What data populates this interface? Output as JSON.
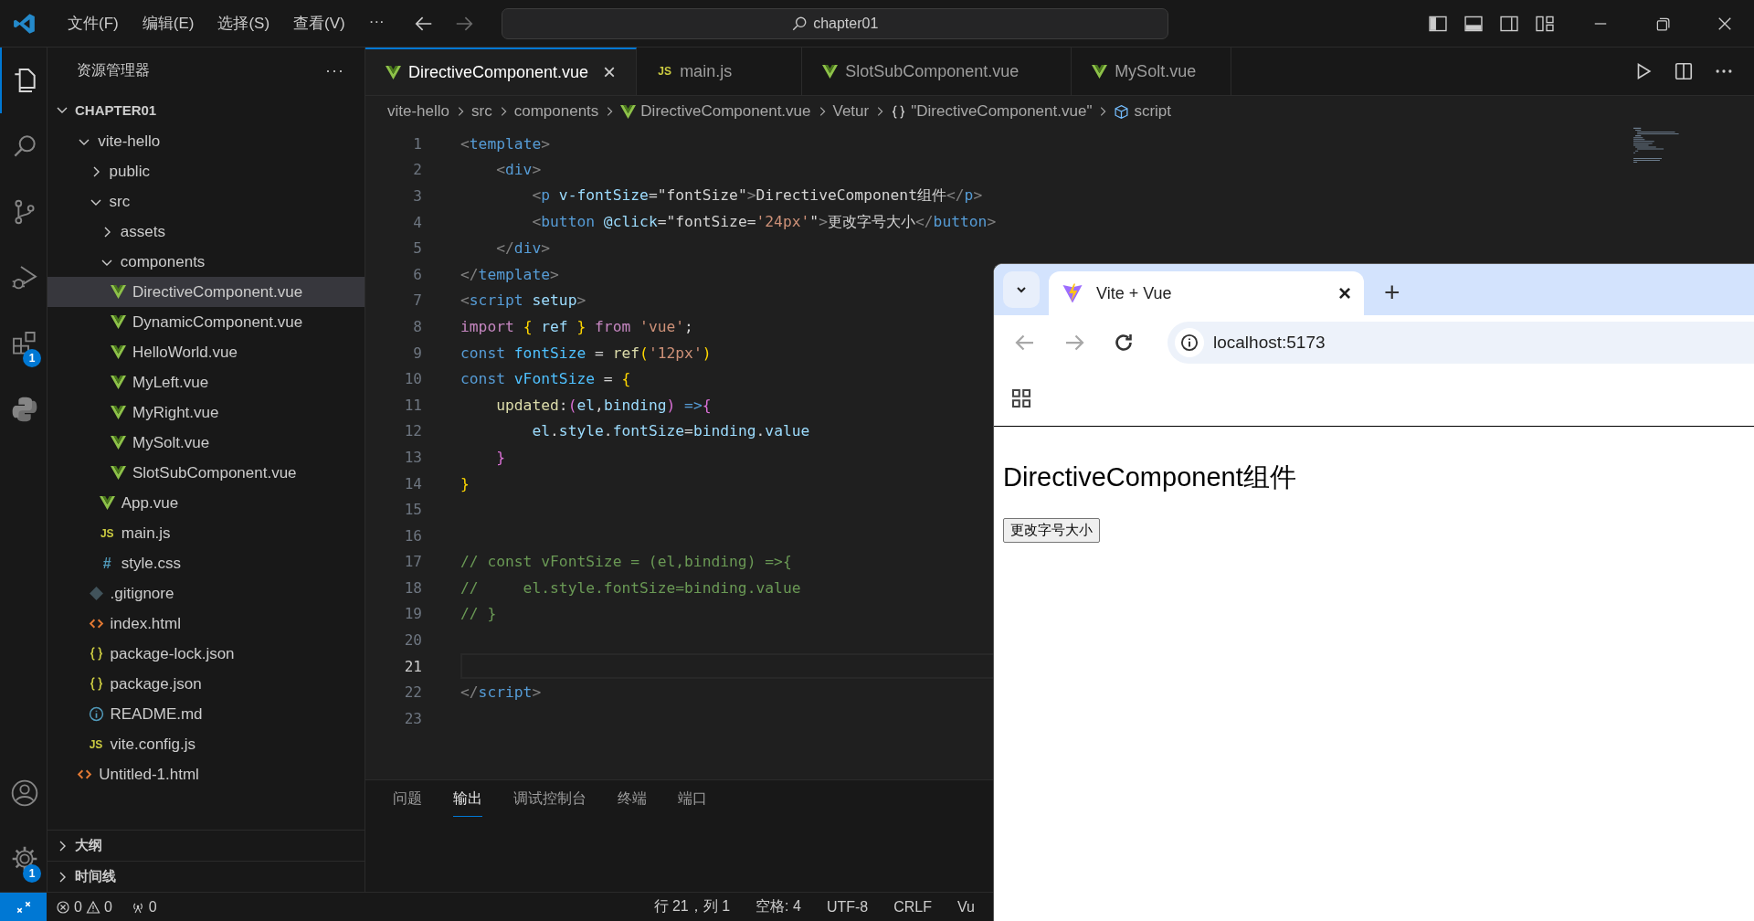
{
  "title_bar": {
    "menus": [
      "文件(F)",
      "编辑(E)",
      "选择(S)",
      "查看(V)",
      "···"
    ],
    "search": {
      "value": "chapter01"
    }
  },
  "activity_bar": {
    "top": [
      {
        "kind": "explorer",
        "selected": true
      },
      {
        "kind": "search",
        "selected": false
      },
      {
        "kind": "source-control",
        "selected": false
      },
      {
        "kind": "run-debug",
        "selected": false
      },
      {
        "kind": "extensions",
        "selected": false,
        "badge": "1"
      },
      {
        "kind": "python",
        "selected": false
      }
    ],
    "bottom": [
      {
        "kind": "account"
      },
      {
        "kind": "settings",
        "badge": "1"
      }
    ]
  },
  "sidebar": {
    "title": "资源管理器",
    "more": "···",
    "section": {
      "label": "CHAPTER01",
      "expanded": true
    },
    "tree": [
      {
        "label": "vite-hello",
        "kind": "folder",
        "expanded": true,
        "selected": false,
        "children": [
          {
            "label": "public",
            "kind": "folder",
            "expanded": false,
            "selected": false
          },
          {
            "label": "src",
            "kind": "folder",
            "expanded": true,
            "selected": false,
            "children": [
              {
                "label": "assets",
                "kind": "folder",
                "expanded": false,
                "selected": false
              },
              {
                "label": "components",
                "kind": "folder",
                "expanded": true,
                "selected": false,
                "children": [
                  {
                    "label": "DirectiveComponent.vue",
                    "kind": "vue",
                    "selected": true
                  },
                  {
                    "label": "DynamicComponent.vue",
                    "kind": "vue",
                    "selected": false
                  },
                  {
                    "label": "HelloWorld.vue",
                    "kind": "vue",
                    "selected": false
                  },
                  {
                    "label": "MyLeft.vue",
                    "kind": "vue",
                    "selected": false
                  },
                  {
                    "label": "MyRight.vue",
                    "kind": "vue",
                    "selected": false
                  },
                  {
                    "label": "MySolt.vue",
                    "kind": "vue",
                    "selected": false
                  },
                  {
                    "label": "SlotSubComponent.vue",
                    "kind": "vue",
                    "selected": false
                  }
                ]
              },
              {
                "label": "App.vue",
                "kind": "vue",
                "selected": false
              },
              {
                "label": "main.js",
                "kind": "js",
                "icon": "JS",
                "selected": false
              },
              {
                "label": "style.css",
                "kind": "css",
                "icon": "#",
                "selected": false
              }
            ]
          },
          {
            "label": ".gitignore",
            "kind": "git",
            "selected": false
          },
          {
            "label": "index.html",
            "kind": "html",
            "selected": false
          },
          {
            "label": "package-lock.json",
            "kind": "json",
            "selected": false
          },
          {
            "label": "package.json",
            "kind": "json",
            "selected": false
          },
          {
            "label": "README.md",
            "kind": "info",
            "selected": false
          },
          {
            "label": "vite.config.js",
            "kind": "js",
            "icon": "JS",
            "selected": false
          }
        ]
      },
      {
        "label": "Untitled-1.html",
        "kind": "html",
        "selected": false
      }
    ],
    "sections": [
      {
        "label": "大纲",
        "expanded": false
      },
      {
        "label": "时间线",
        "expanded": false
      }
    ]
  },
  "editor": {
    "tabs": [
      {
        "label": "DirectiveComponent.vue",
        "kind": "vue",
        "selected": true,
        "close": "×"
      },
      {
        "label": "main.js",
        "kind": "js",
        "icon": "JS",
        "selected": false
      },
      {
        "label": "SlotSubComponent.vue",
        "kind": "vue",
        "selected": false
      },
      {
        "label": "MySolt.vue",
        "kind": "vue",
        "selected": false
      }
    ],
    "breadcrumbs": [
      {
        "label": "vite-hello",
        "kind": "folder"
      },
      {
        "label": "src",
        "kind": "folder"
      },
      {
        "label": "components",
        "kind": "folder"
      },
      {
        "label": "DirectiveComponent.vue",
        "kind": "vue"
      },
      {
        "label": "Vetur",
        "kind": "folder"
      },
      {
        "label": "\"DirectiveComponent.vue\"",
        "kind": "object"
      },
      {
        "label": "script",
        "kind": "module"
      }
    ],
    "lines": [
      {
        "number": "1",
        "current": false,
        "tokens": [
          {
            "kind": "punct",
            "text": "<"
          },
          {
            "kind": "tag",
            "text": "template"
          },
          {
            "kind": "punct",
            "text": ">"
          }
        ]
      },
      {
        "number": "2",
        "current": false,
        "tokens": [
          {
            "kind": "punct",
            "text": "    <"
          },
          {
            "kind": "tag",
            "text": "div"
          },
          {
            "kind": "punct",
            "text": ">"
          }
        ]
      },
      {
        "number": "3",
        "current": false,
        "tokens": [
          {
            "kind": "punct",
            "text": "        <"
          },
          {
            "kind": "tag",
            "text": "p"
          },
          {
            "kind": "attr",
            "text": " v-fontSize"
          },
          {
            "kind": "text",
            "text": "=\"fontSize\""
          },
          {
            "kind": "punct",
            "text": ">"
          },
          {
            "kind": "text",
            "text": "DirectiveComponent组件"
          },
          {
            "kind": "punct",
            "text": "</"
          },
          {
            "kind": "tag",
            "text": "p"
          },
          {
            "kind": "punct",
            "text": ">"
          }
        ]
      },
      {
        "number": "4",
        "current": false,
        "tokens": [
          {
            "kind": "punct",
            "text": "        <"
          },
          {
            "kind": "tag",
            "text": "button"
          },
          {
            "kind": "attr",
            "text": " @click"
          },
          {
            "kind": "text",
            "text": "=\"fontSize="
          },
          {
            "kind": "str",
            "text": "'24px'"
          },
          {
            "kind": "text",
            "text": "\""
          },
          {
            "kind": "punct",
            "text": ">"
          },
          {
            "kind": "text",
            "text": "更改字号大小"
          },
          {
            "kind": "punct",
            "text": "</"
          },
          {
            "kind": "tag",
            "text": "button"
          },
          {
            "kind": "punct",
            "text": ">"
          }
        ]
      },
      {
        "number": "5",
        "current": false,
        "tokens": [
          {
            "kind": "punct",
            "text": "    </"
          },
          {
            "kind": "tag",
            "text": "div"
          },
          {
            "kind": "punct",
            "text": ">"
          }
        ]
      },
      {
        "number": "6",
        "current": false,
        "tokens": [
          {
            "kind": "punct",
            "text": "</"
          },
          {
            "kind": "tag",
            "text": "template"
          },
          {
            "kind": "punct",
            "text": ">"
          }
        ]
      },
      {
        "number": "7",
        "current": false,
        "tokens": [
          {
            "kind": "punct",
            "text": "<"
          },
          {
            "kind": "tag",
            "text": "script"
          },
          {
            "kind": "attr",
            "text": " setup"
          },
          {
            "kind": "punct",
            "text": ">"
          }
        ]
      },
      {
        "number": "8",
        "current": false,
        "tokens": [
          {
            "kind": "keyword",
            "text": "import "
          },
          {
            "kind": "brace1",
            "text": "{"
          },
          {
            "kind": "attr",
            "text": " ref "
          },
          {
            "kind": "brace1",
            "text": "}"
          },
          {
            "kind": "keyword",
            "text": " from"
          },
          {
            "kind": "str",
            "text": " 'vue'"
          },
          {
            "kind": "text",
            "text": ";"
          }
        ]
      },
      {
        "number": "9",
        "current": false,
        "tokens": [
          {
            "kind": "storage",
            "text": "const"
          },
          {
            "kind": "var",
            "text": " fontSize"
          },
          {
            "kind": "text",
            "text": " = "
          },
          {
            "kind": "func",
            "text": "ref"
          },
          {
            "kind": "brace1",
            "text": "("
          },
          {
            "kind": "str",
            "text": "'12px'"
          },
          {
            "kind": "brace1",
            "text": ")"
          }
        ]
      },
      {
        "number": "10",
        "current": false,
        "tokens": [
          {
            "kind": "storage",
            "text": "const"
          },
          {
            "kind": "var",
            "text": " vFontSize"
          },
          {
            "kind": "text",
            "text": " = "
          },
          {
            "kind": "brace1",
            "text": "{"
          }
        ]
      },
      {
        "number": "11",
        "current": false,
        "tokens": [
          {
            "kind": "func",
            "text": "    updated"
          },
          {
            "kind": "text",
            "text": ":"
          },
          {
            "kind": "brace2",
            "text": "("
          },
          {
            "kind": "attr",
            "text": "el"
          },
          {
            "kind": "text",
            "text": ","
          },
          {
            "kind": "attr",
            "text": "binding"
          },
          {
            "kind": "brace2",
            "text": ")"
          },
          {
            "kind": "storage",
            "text": " =>"
          },
          {
            "kind": "brace2",
            "text": "{"
          }
        ]
      },
      {
        "number": "12",
        "current": false,
        "tokens": [
          {
            "kind": "attr",
            "text": "        el"
          },
          {
            "kind": "text",
            "text": "."
          },
          {
            "kind": "attr",
            "text": "style"
          },
          {
            "kind": "text",
            "text": "."
          },
          {
            "kind": "attr",
            "text": "fontSize"
          },
          {
            "kind": "text",
            "text": "="
          },
          {
            "kind": "attr",
            "text": "binding"
          },
          {
            "kind": "text",
            "text": "."
          },
          {
            "kind": "attr",
            "text": "value"
          }
        ]
      },
      {
        "number": "13",
        "current": false,
        "tokens": [
          {
            "kind": "brace2",
            "text": "    }"
          }
        ]
      },
      {
        "number": "14",
        "current": false,
        "tokens": [
          {
            "kind": "brace1",
            "text": "}"
          }
        ]
      },
      {
        "number": "15",
        "current": false
      },
      {
        "number": "16",
        "current": false
      },
      {
        "number": "17",
        "current": false,
        "tokens": [
          {
            "kind": "comment",
            "text": "// const vFontSize = (el,binding) =>{"
          }
        ]
      },
      {
        "number": "18",
        "current": false,
        "tokens": [
          {
            "kind": "comment",
            "text": "//     el.style.fontSize=binding.value"
          }
        ]
      },
      {
        "number": "19",
        "current": false,
        "tokens": [
          {
            "kind": "comment",
            "text": "// }"
          }
        ]
      },
      {
        "number": "20",
        "current": false
      },
      {
        "number": "21",
        "current": true
      },
      {
        "number": "22",
        "current": false,
        "tokens": [
          {
            "kind": "punct",
            "text": "</"
          },
          {
            "kind": "tag",
            "text": "script"
          },
          {
            "kind": "punct",
            "text": ">"
          }
        ]
      },
      {
        "number": "23",
        "current": false
      }
    ]
  },
  "panel": {
    "tabs": [
      {
        "label": "问题",
        "selected": false
      },
      {
        "label": "输出",
        "selected": true
      },
      {
        "label": "调试控制台",
        "selected": false
      },
      {
        "label": "终端",
        "selected": false
      },
      {
        "label": "端口",
        "selected": false
      }
    ]
  },
  "status_bar": {
    "errors": "0",
    "warnings": "0",
    "ports": "0",
    "items": [
      "行 21，列 1",
      "空格: 4",
      "UTF-8",
      "CRLF",
      "Vu"
    ]
  },
  "browser": {
    "tab": {
      "title": "Vite + Vue",
      "close": "×"
    },
    "new_tab": "+",
    "nav": [
      {
        "kind": "back",
        "disabled": true
      },
      {
        "kind": "forward",
        "disabled": true
      },
      {
        "kind": "reload",
        "disabled": false
      }
    ],
    "address": "localhost:5173",
    "page": {
      "heading": "DirectiveComponent组件",
      "button": "更改字号大小"
    }
  }
}
